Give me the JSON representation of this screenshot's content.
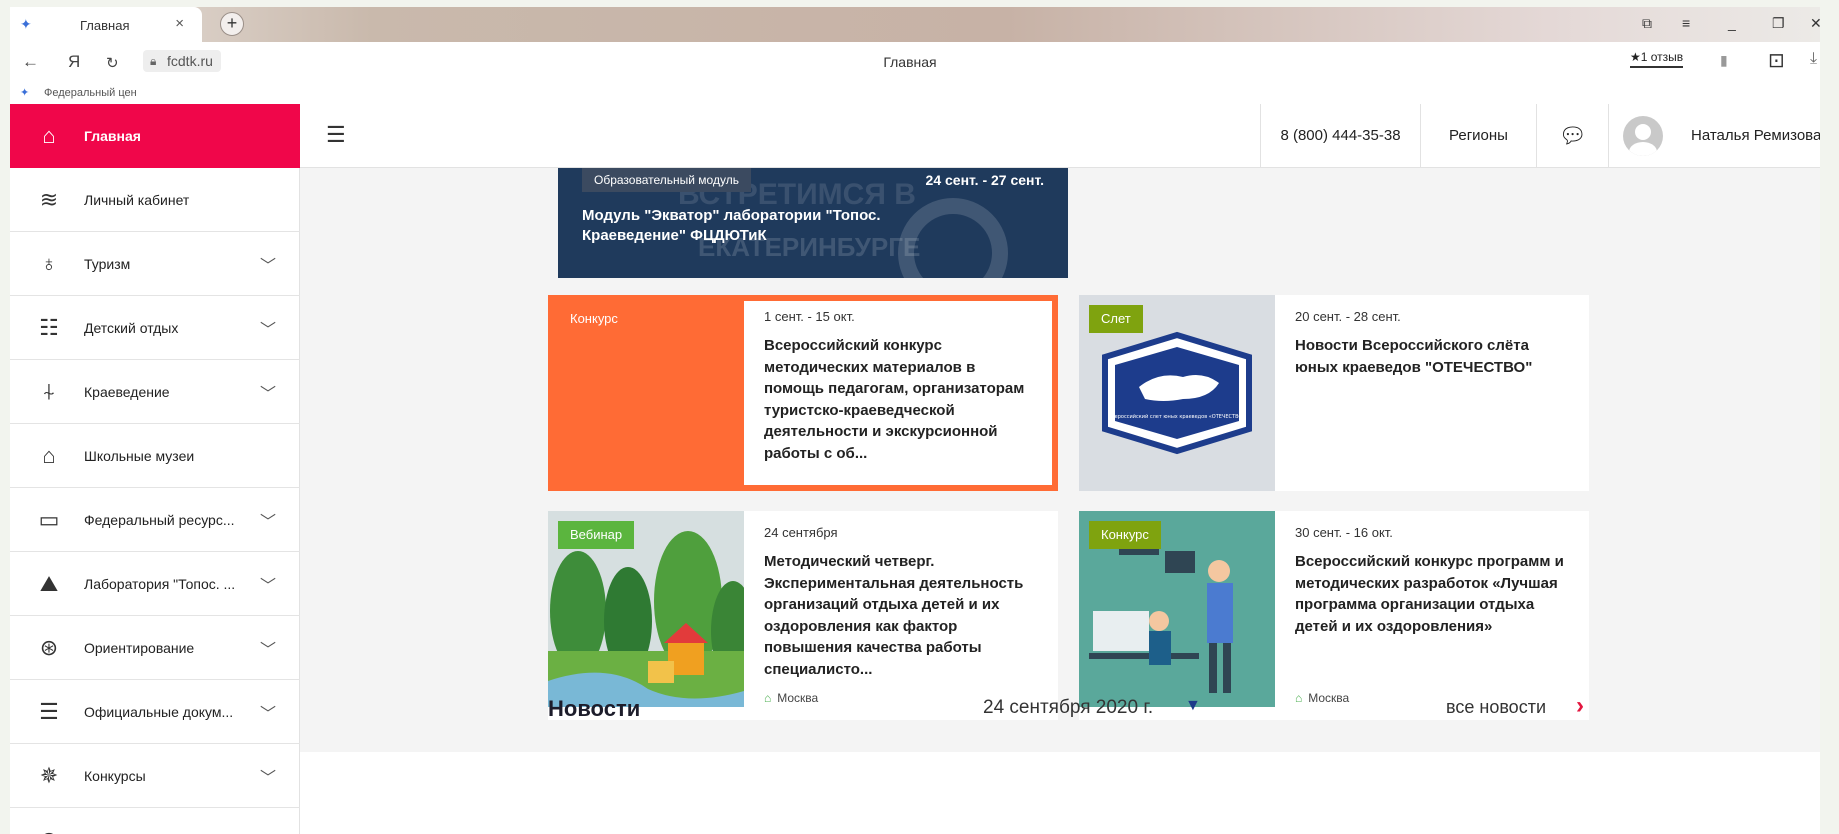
{
  "browser": {
    "tab_title": "Главная",
    "tab_close": "×",
    "new_tab": "+",
    "url": "fcdtk.ru",
    "page_title": "Главная",
    "review": "★1 отзыв",
    "bookmark_bar_label": "Федеральный цен"
  },
  "sidebar": {
    "items": [
      {
        "label": "Главная",
        "icon": "home-icon",
        "active": true
      },
      {
        "label": "Личный кабинет",
        "icon": "layers-icon"
      },
      {
        "label": "Туризм",
        "icon": "balloon-icon"
      },
      {
        "label": "Детский отдых",
        "icon": "bunk-bed-icon"
      },
      {
        "label": "Краеведение",
        "icon": "signpost-icon"
      },
      {
        "label": "Школьные музеи",
        "icon": "museum-icon"
      },
      {
        "label": "Федеральный ресурс...",
        "icon": "archive-icon"
      },
      {
        "label": "Лаборатория \"Топос. ...",
        "icon": "mountain-icon"
      },
      {
        "label": "Ориентирование",
        "icon": "compass-icon"
      },
      {
        "label": "Официальные докум...",
        "icon": "document-lines-icon"
      },
      {
        "label": "Конкурсы",
        "icon": "star-badge-icon"
      }
    ]
  },
  "topbar": {
    "phone": "8 (800) 444-35-38",
    "regions": "Регионы",
    "user_name": "Наталья Ремизова"
  },
  "hero": {
    "tag": "Образовательный модуль",
    "date": "24 сент. - 27 сент.",
    "title": "Модуль \"Экватор\" лаборатории \"Топос. Краеведение\" ФЦДЮТиК"
  },
  "cards": [
    {
      "badge": "Конкурс",
      "badge_color": "#ff6b35",
      "date": "1 сент. - 15 окт.",
      "title": "Всероссийский конкурс методических материалов в помощь педагогам, организаторам туристско-краеведческой деятельности и экскурсионной работы с об..."
    },
    {
      "badge": "Слет",
      "badge_color": "#7fa30f",
      "date": "20 сент. - 28 сент.",
      "title": "Новости Всероссийского слёта юных краеведов \"ОТЕЧЕСТВО\"",
      "emblem_text": "Всероссийский слет юных краеведов «ОТЕЧЕСТВО»"
    },
    {
      "badge": "Вебинар",
      "badge_color": "#5bb53e",
      "date": "24 сентября",
      "title": "Методический четверг. Экспериментальная деятельность организаций отдыха детей и их оздоровления как фактор повышения качества работы специалисто...",
      "location": "Москва"
    },
    {
      "badge": "Конкурс",
      "badge_color": "#7fa30f",
      "date": "30 сент. - 16 окт.",
      "title": "Всероссийский конкурс программ и методических разработок «Лучшая программа организации отдыха детей и их оздоровления»",
      "location": "Москва"
    }
  ],
  "news": {
    "title": "Новости",
    "date": "24 сентября 2020 г.",
    "all": "все новости"
  }
}
